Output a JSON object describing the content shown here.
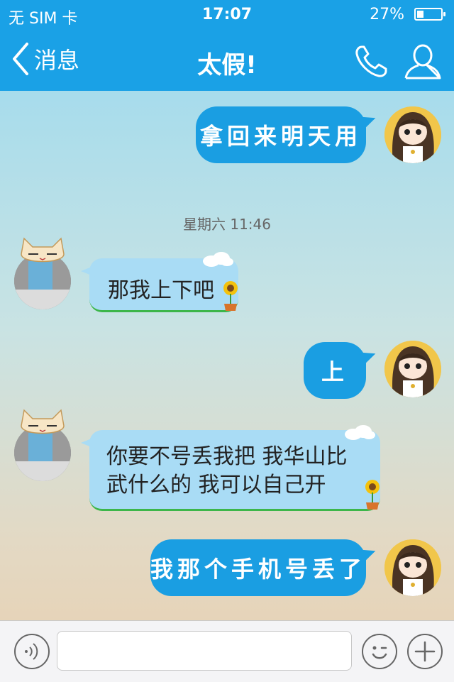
{
  "status_bar": {
    "carrier": "无 SIM 卡",
    "time": "17:07",
    "battery_percent_label": "27%",
    "battery_level": 0.27
  },
  "nav": {
    "back_label": "消息",
    "title": "太假!",
    "phone_icon": "phone-icon",
    "profile_icon": "profile-icon"
  },
  "chat": {
    "timestamp": "星期六 11:46",
    "messages": [
      {
        "sender": "self",
        "text": "拿回来明天用"
      },
      {
        "sender": "other",
        "text": "那我上下吧"
      },
      {
        "sender": "self",
        "text": "上"
      },
      {
        "sender": "other",
        "text_line1": "你要不号丢我把 我华山比",
        "text_line2": "武什么的 我可以自己开"
      },
      {
        "sender": "self",
        "text": "我那个手机号丢了"
      }
    ]
  },
  "input_bar": {
    "placeholder": "",
    "voice_icon": "voice-icon",
    "emoji_icon": "emoji-icon",
    "add_icon": "plus-icon"
  },
  "colors": {
    "accent": "#1aa1e6",
    "outgoing_bubble": "#1a9ee2",
    "incoming_bubble": "#a9dcf5"
  }
}
